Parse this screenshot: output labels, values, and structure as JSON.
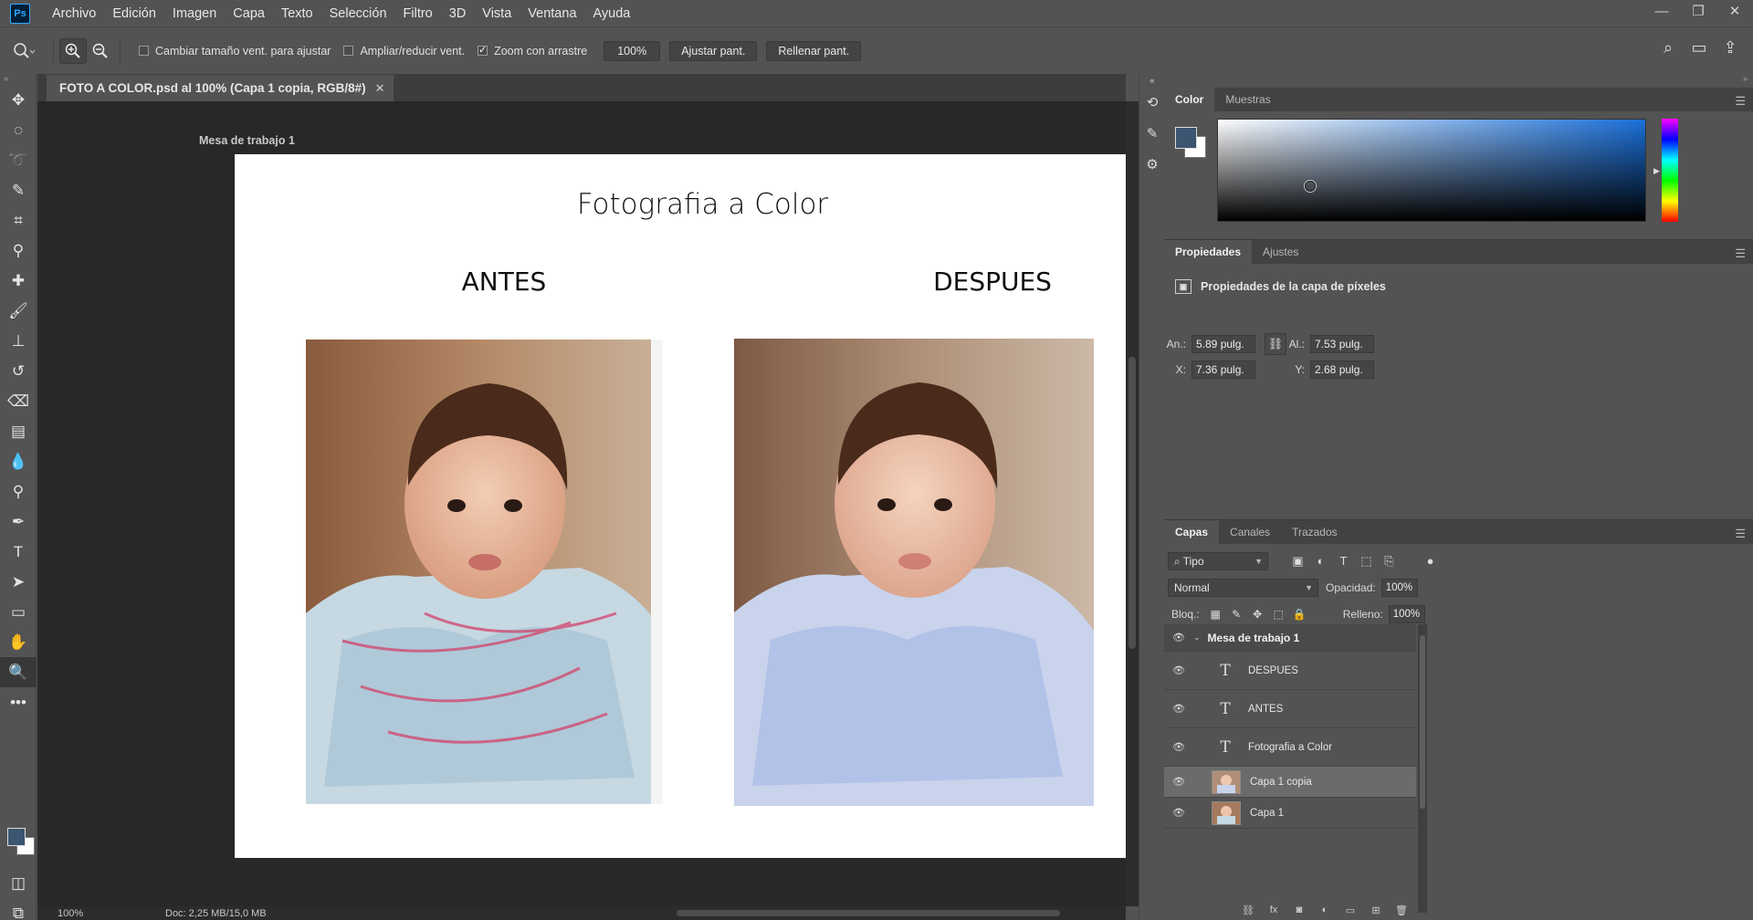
{
  "app": {
    "logo": "Ps"
  },
  "menu": [
    "Archivo",
    "Edición",
    "Imagen",
    "Capa",
    "Texto",
    "Selección",
    "Filtro",
    "3D",
    "Vista",
    "Ventana",
    "Ayuda"
  ],
  "options": {
    "resize_windows": "Cambiar tamaño vent. para ajustar",
    "zoom_all_windows": "Ampliar/reducir vent.",
    "scrubby_zoom": "Zoom con arrastre",
    "zoom_value": "100%",
    "fit_screen": "Ajustar pant.",
    "fill_screen": "Rellenar pant."
  },
  "document": {
    "tab_title": "FOTO A COLOR.psd al 100% (Capa 1 copia, RGB/8#)",
    "artboard_label": "Mesa de trabajo 1",
    "title": "Fotografia a Color",
    "before_label": "ANTES",
    "after_label": "DESPUES"
  },
  "status": {
    "zoom": "100%",
    "doc": "Doc: 2,25 MB/15,0 MB"
  },
  "color_panel": {
    "tabs": [
      "Color",
      "Muestras"
    ],
    "foreground": "#3c5570",
    "background": "#ffffff"
  },
  "properties_panel": {
    "tabs": [
      "Propiedades",
      "Ajustes"
    ],
    "title": "Propiedades de la capa de píxeles",
    "width_label": "An.:",
    "width": "5.89 pulg.",
    "height_label": "Al.:",
    "height": "7.53 pulg.",
    "x_label": "X:",
    "x": "7.36 pulg.",
    "y_label": "Y:",
    "y": "2.68 pulg."
  },
  "layers_panel": {
    "tabs": [
      "Capas",
      "Canales",
      "Trazados"
    ],
    "filter": "Tipo",
    "blend_mode": "Normal",
    "opacity_label": "Opacidad:",
    "opacity": "100%",
    "lock_label": "Bloq.:",
    "fill_label": "Relleno:",
    "fill": "100%",
    "group": "Mesa de trabajo 1",
    "layers": [
      {
        "name": "DESPUES",
        "kind": "text"
      },
      {
        "name": "ANTES",
        "kind": "text"
      },
      {
        "name": "Fotografia a Color",
        "kind": "text"
      },
      {
        "name": "Capa 1 copia",
        "kind": "pixel",
        "selected": true
      },
      {
        "name": "Capa 1",
        "kind": "pixel"
      }
    ]
  }
}
